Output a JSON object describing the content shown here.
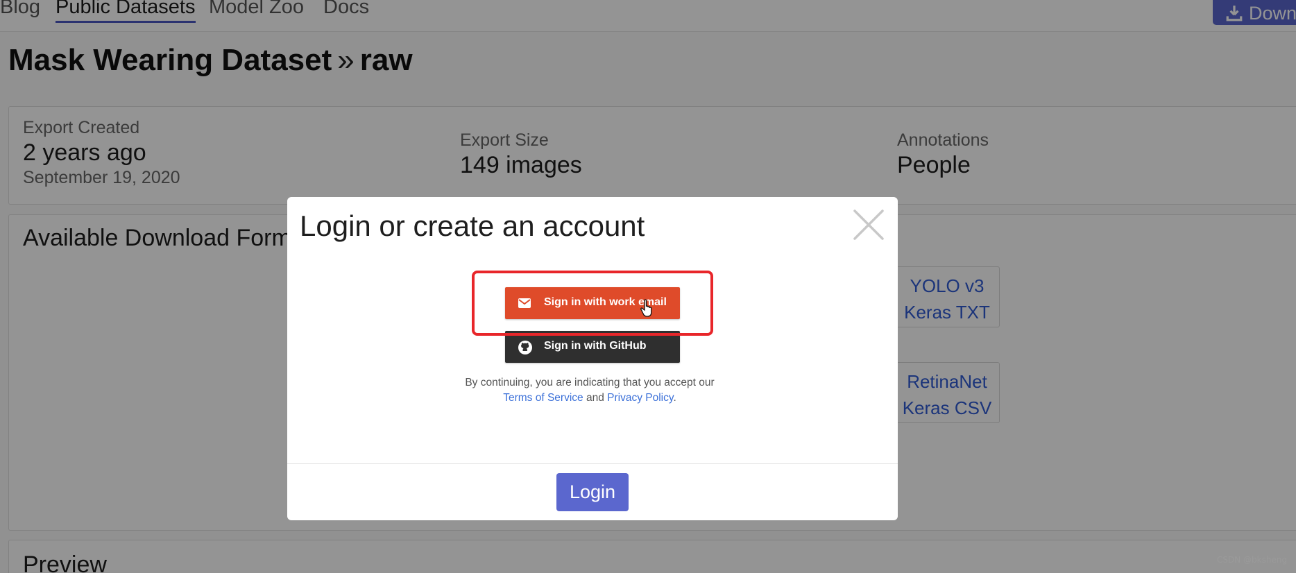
{
  "nav": {
    "links": [
      "Blog",
      "Public Datasets",
      "Model Zoo",
      "Docs"
    ],
    "active": "Public Datasets",
    "download_label": "Down"
  },
  "page": {
    "dataset": "Mask Wearing Dataset",
    "separator": "»",
    "version": "raw"
  },
  "info": {
    "created_label": "Export Created",
    "created_value": "2 years ago",
    "created_date": "September 19, 2020",
    "size_label": "Export Size",
    "size_value": "149 images",
    "annotations_label": "Annotations",
    "annotations_value": "People"
  },
  "formats": {
    "title": "Available Download Form",
    "tiles": [
      {
        "line1": "YOLO v3",
        "line2": "Keras TXT"
      },
      {
        "line1": "RetinaNet",
        "line2": "Keras CSV"
      }
    ]
  },
  "preview": {
    "title": "Preview"
  },
  "modal": {
    "title": "Login or create an account",
    "email_button": "Sign in with work email",
    "github_button": "Sign in with GitHub",
    "terms_prefix": "By continuing, you are indicating that you accept our",
    "terms_link": "Terms of Service",
    "terms_and": "and",
    "privacy_link": "Privacy Policy",
    "terms_suffix": ".",
    "login_button": "Login"
  },
  "watermark": "CSDN @bksheng",
  "colors": {
    "email_button": "#df4b2a",
    "github_button": "#2f2f2f",
    "primary": "#5b67ce",
    "highlight": "#e8262a",
    "link": "#3a6fd8"
  }
}
